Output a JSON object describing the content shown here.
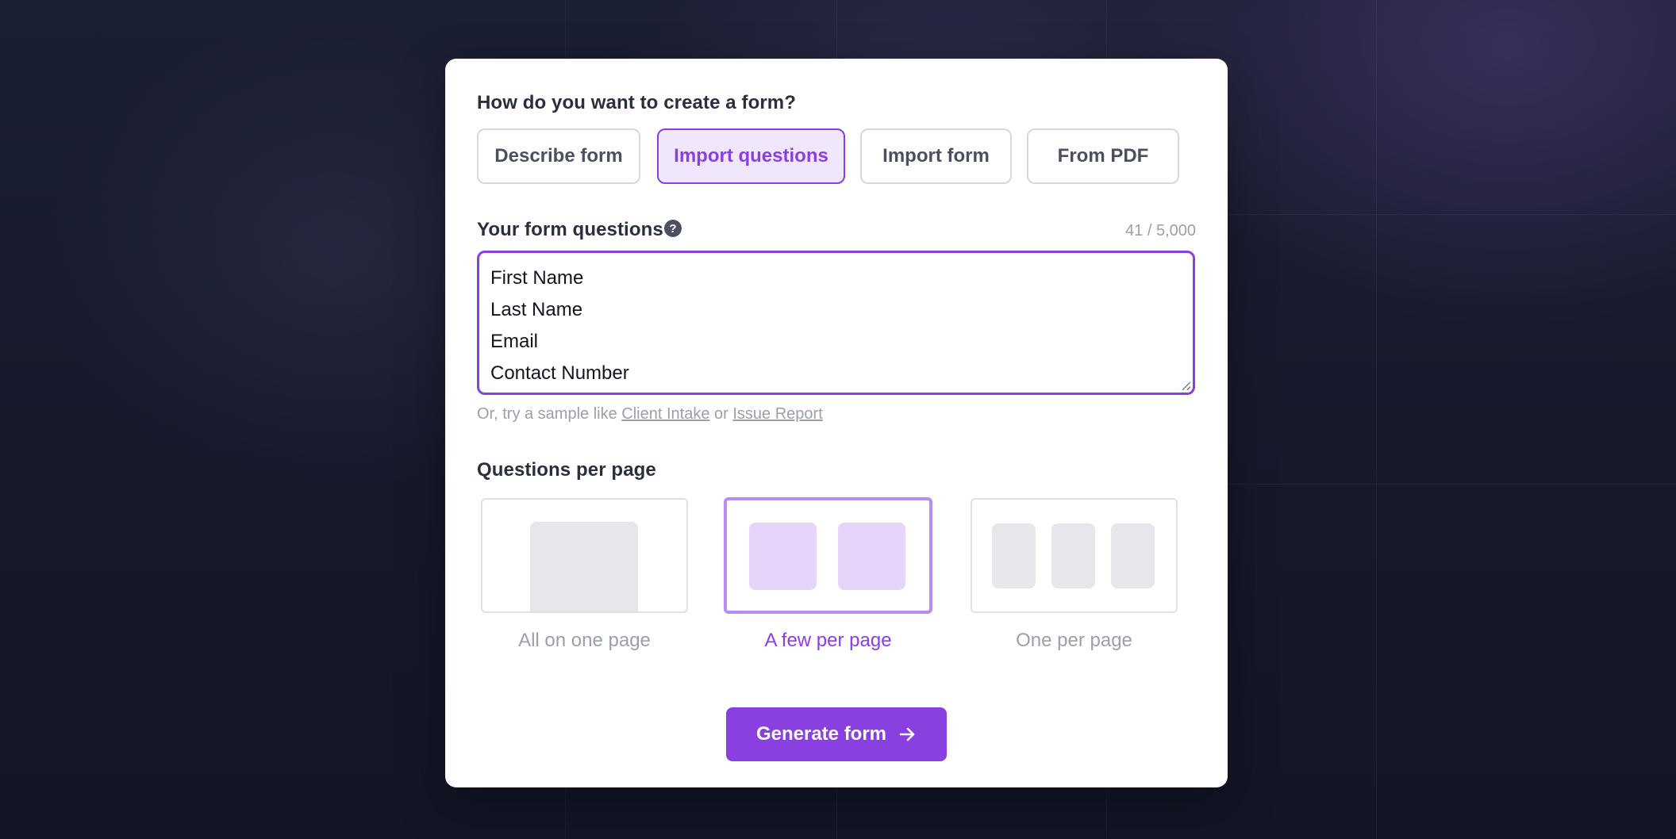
{
  "create_section": {
    "title": "How do you want to create a form?",
    "methods": [
      {
        "label": "Describe form"
      },
      {
        "label": "Import questions"
      },
      {
        "label": "Import form"
      },
      {
        "label": "From PDF"
      }
    ],
    "selected_method": "Import questions"
  },
  "questions_section": {
    "title": "Your form questions",
    "help_icon": "question-circle-icon",
    "counter": "41 / 5,000",
    "lines": [
      "First Name",
      "Last Name",
      "Email",
      "Contact Number"
    ],
    "sample_prefix": "Or, try a sample like",
    "sample_links": [
      "Client Intake",
      "Issue Report"
    ],
    "sample_joiner": "or"
  },
  "per_page_section": {
    "title": "Questions per page",
    "options": [
      {
        "label": "All on one page"
      },
      {
        "label": "A few per page"
      },
      {
        "label": "One per page"
      }
    ],
    "selected_option": "A few per page"
  },
  "generate_button": {
    "label": "Generate form",
    "icon": "arrow-right-icon"
  },
  "colors": {
    "accent": "#8a3fe0",
    "accent_light": "#f1e7fd",
    "background": "#151a2b"
  }
}
